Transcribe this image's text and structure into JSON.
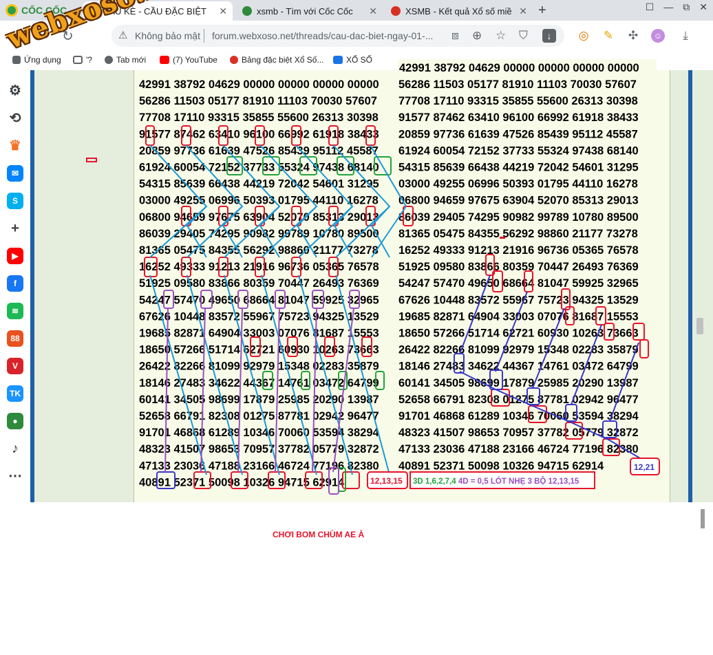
{
  "browser": {
    "brand": "CỐC CỐC",
    "tabs": [
      {
        "title": "CẦU KÈ - CẦU ĐẶC BIỆT",
        "active": true,
        "favicon_color": "#f5b301"
      },
      {
        "title": "xsmb - Tìm với Cốc Cốc",
        "active": false,
        "favicon_color": "#2f8a3c"
      },
      {
        "title": "XSMB - Kết quả Xổ số miề",
        "active": false,
        "favicon_color": "#d93025"
      }
    ],
    "new_tab": "+",
    "window_controls": [
      "☐",
      "—",
      "⧉",
      "✕"
    ]
  },
  "toolbar": {
    "back": "←",
    "forward": "→",
    "reload": "↻",
    "security_warning": "Không bảo mật",
    "url": "forum.webxoso.net/threads/cau-dac-biet-ngay-01-..."
  },
  "bookmarks": [
    {
      "label": "Ứng dụng",
      "icon_color": "#5f6368"
    },
    {
      "label": "'?",
      "icon_color": "#5f6368"
    },
    {
      "label": "Tab mới",
      "icon_color": "#5f6368"
    },
    {
      "label": "(7) YouTube",
      "icon_color": "#ff0000"
    },
    {
      "label": "Bảng đặc biệt Xổ Số...",
      "icon_color": "#d93025"
    },
    {
      "label": "XỔ SỐ",
      "icon_color": "#1a73e8"
    }
  ],
  "sidebar_icons": [
    {
      "name": "settings",
      "glyph": "⚙",
      "color": "#3c4043"
    },
    {
      "name": "history",
      "glyph": "⟲",
      "color": "#3c4043"
    },
    {
      "name": "crown",
      "glyph": "♛",
      "color": "#f27024"
    },
    {
      "name": "messenger",
      "glyph": "✉",
      "color": "#0084ff"
    },
    {
      "name": "skype",
      "glyph": "S",
      "color": "#00aff0"
    },
    {
      "name": "add",
      "glyph": "+",
      "color": "#3c4043"
    },
    {
      "name": "youtube",
      "glyph": "▶",
      "color": "#ff0000"
    },
    {
      "name": "facebook",
      "glyph": "f",
      "color": "#1877f2"
    },
    {
      "name": "spotify",
      "glyph": "≋",
      "color": "#1db954"
    },
    {
      "name": "app-88",
      "glyph": "88",
      "color": "#e8521f"
    },
    {
      "name": "vtv",
      "glyph": "V",
      "color": "#d9232a"
    },
    {
      "name": "tiki",
      "glyph": "TK",
      "color": "#1a94ff"
    },
    {
      "name": "pin",
      "glyph": "●",
      "color": "#2f8a3c"
    },
    {
      "name": "bell",
      "glyph": "♪",
      "color": "#3c4043"
    },
    {
      "name": "more",
      "glyph": "⋯",
      "color": "#3c4043"
    }
  ],
  "results": {
    "first_row_right": "42991 38792 04629 00000 00000 00000 00000",
    "rows": [
      [
        "42991 38792 04629 00000 00000 00000 00000",
        "56286 11503 05177 81910 11103 70030 57607"
      ],
      [
        "56286 11503 05177 81910 11103 70030 57607",
        "77708 17110 93315 35855 55600 26313 30398"
      ],
      [
        "77708 17110 93315 35855 55600 26313 30398",
        "91577 87462 63410 96100 66992 61918 38433"
      ],
      [
        "91577 87462 63410 96100 66992 61918 38433",
        "20859 97736 61639 47526 85439 95112 45587"
      ],
      [
        "20859 97736 61639 47526 85439 95112 45587",
        "61924 60054 72152 37733 55324 97438 68140"
      ],
      [
        "61924 60054 72152 37733 55324 97438 68140",
        "54315 85639 66438 44219 72042 54601 31295"
      ],
      [
        "54315 85639 66438 44219 72042 54601 31295",
        "03000 49255 06996 50393 01795 44110 16278"
      ],
      [
        "03000 49255 06996 50393 01795 44110 16278",
        "06800 94659 97675 63904 52070 85313 29013"
      ],
      [
        "06800 94659 97675 63904 52070 85313 29013",
        "86039 29405 74295 90982 99789 10780 89500"
      ],
      [
        "86039 29405 74295 90982 99789 10780 89500",
        "81365 05475 84355 56292 98860 21177 73278"
      ],
      [
        "81365 05475 84355 56292 98860 21177 73278",
        "16252 49333 91213 21916 96736 05365 76578"
      ],
      [
        "16252 49333 91213 21916 96736 05365 76578",
        "51925 09580 83866 80359 70447 26493 76369"
      ],
      [
        "51925 09580 83866 80359 70447 26493 76369",
        "54247 57470 49650 68664 81047 59925 32965"
      ],
      [
        "54247 57470 49650 68664 81047 59925 32965",
        "67626 10448 83572 55967 75723 94325 13529"
      ],
      [
        "67626 10448 83572 55967 75723 94325 13529",
        "19685 82871 64904 33003 07076 81687 15553"
      ],
      [
        "19685 82871 64904 33003 07076 81687 15553",
        "18650 57266 51714 62721 60930 10263 73663"
      ],
      [
        "18650 57266 51714 62721 60930 10263 73663",
        "26422 82266 81099 92979 15348 02283 35879"
      ],
      [
        "26422 82266 81099 92979 15348 02283 35879",
        "18146 27483 34622 44367 14761 03472 64799"
      ],
      [
        "18146 27483 34622 44367 14761 03472 64799",
        "60141 34505 98699 17879 25985 20290 13987"
      ],
      [
        "60141 34505 98699 17879 25985 20290 13987",
        "52658 66791 82308 01275 87781 02942 96477"
      ],
      [
        "52658 66791 82308 01275 87781 02942 96477",
        "91701 46868 61289 10346 70060 53594 38294"
      ],
      [
        "91701 46868 61289 10346 70060 53594 38294",
        "48323 41507 98653 70957 37782 05779 32872"
      ],
      [
        "48323 41507 98653 70957 37782 05779 32872",
        "47133 23036 47188 23166 46724 77196 82380"
      ],
      [
        "47133 23036 47188 23166 46724 77196 82380",
        "40891 52371 50098 10326 94715 62914"
      ],
      [
        "40891 52371 50098 10326 94715 62914",
        ""
      ]
    ],
    "callout_red": "12,13,15",
    "callout_note_green": "3D 1,6,2,7,4",
    "callout_note_purple": "4D = 0,5 LÓT NHẸ 3 BỘ 12,13,15",
    "callout_blue": "12,21",
    "colors": {
      "red": "#e8132a",
      "green": "#22a33a",
      "purple": "#9b4fc0",
      "blue": "#3838c8",
      "cyan": "#1b9ad6"
    }
  },
  "footer_caption": "CHƠI BOM CHÙM AE À",
  "watermark": "webxoso.net"
}
